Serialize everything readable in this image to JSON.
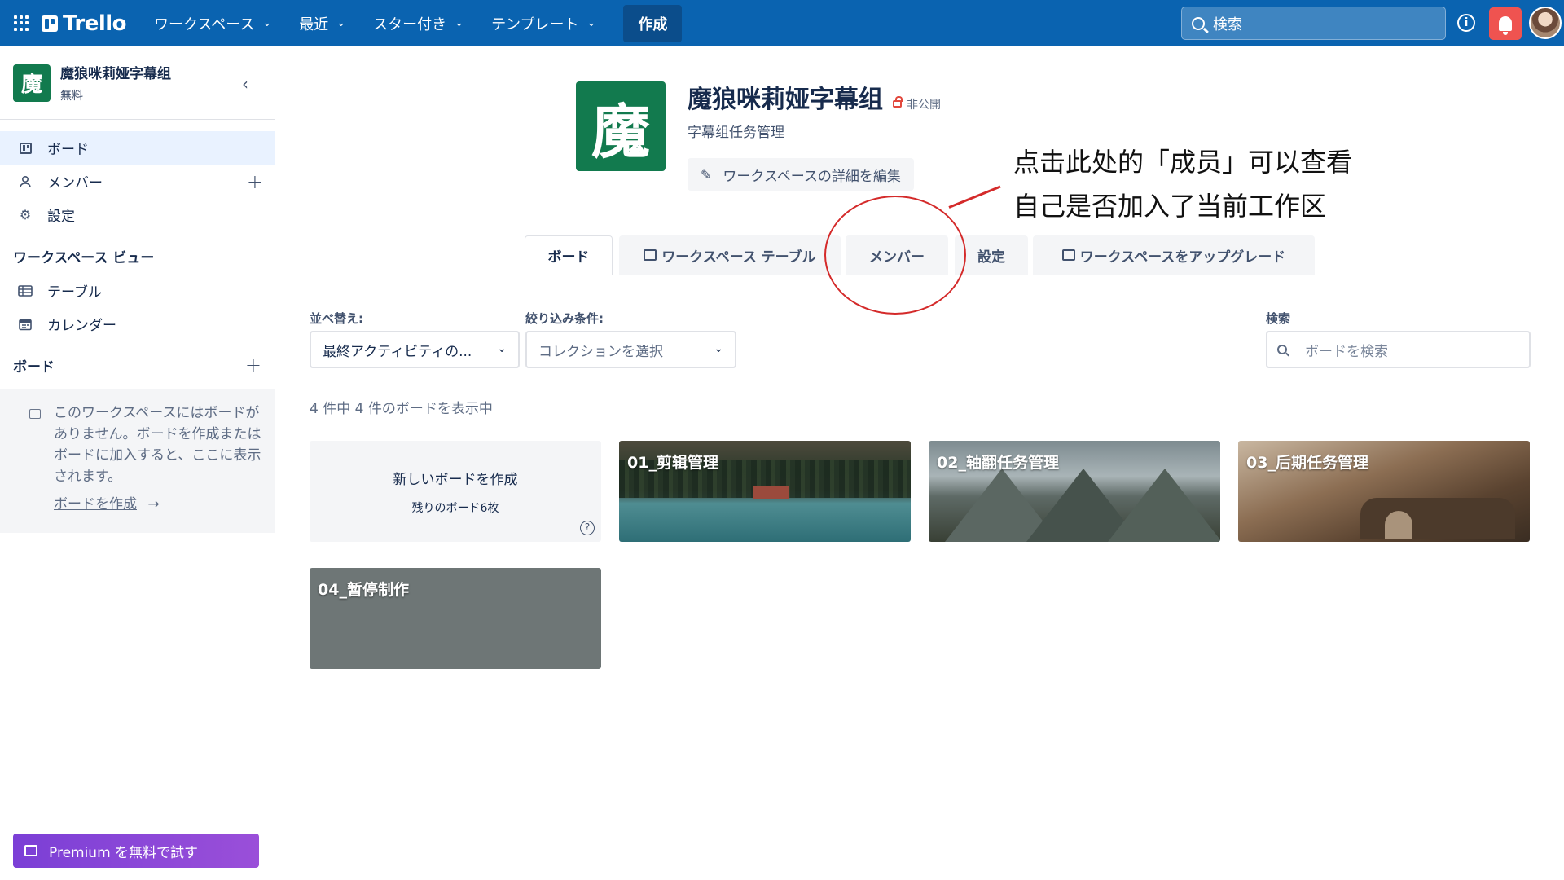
{
  "topbar": {
    "logo": "Trello",
    "nav": [
      {
        "label": "ワークスペース"
      },
      {
        "label": "最近"
      },
      {
        "label": "スター付き"
      },
      {
        "label": "テンプレート"
      }
    ],
    "create_label": "作成",
    "search_placeholder": "検索",
    "info_icon_label": "i",
    "accent": "#0a63b0",
    "notification_color": "#ef5350"
  },
  "sidebar": {
    "workspace_initial": "魔",
    "workspace_name": "魔狼咪莉娅字幕组",
    "plan": "無料",
    "collapse_icon": "‹",
    "items": [
      {
        "label": "ボード",
        "icon": "board-icon"
      },
      {
        "label": "メンバー",
        "icon": "person-icon",
        "plus": "+"
      },
      {
        "label": "設定",
        "icon": "gear-icon"
      }
    ],
    "views_heading": "ワークスペース ビュー",
    "views": [
      {
        "label": "テーブル",
        "icon": "table-icon"
      },
      {
        "label": "カレンダー",
        "icon": "calendar-icon"
      }
    ],
    "boards_heading": "ボード",
    "boards_plus": "+",
    "empty_text": "このワークスペースにはボードがありません。ボードを作成またはボードに加入すると、ここに表示されます。",
    "empty_link": "ボードを作成",
    "empty_link_arrow": "→",
    "premium_label": "Premium を無料で試す",
    "premium_color": "#8a47d8"
  },
  "workspace": {
    "logo_char": "魔",
    "title": "魔狼咪莉娅字幕组",
    "privacy": "非公開",
    "description": "字幕组任务管理",
    "edit_label": "ワークスペースの詳細を編集",
    "edit_icon": "✎",
    "logo_color": "#127a4e"
  },
  "tabs": [
    {
      "label": "ボード",
      "active": true
    },
    {
      "label": "ワークスペース テーブル",
      "icon": "premium-icon"
    },
    {
      "label": "メンバー"
    },
    {
      "label": "設定"
    },
    {
      "label": "ワークスペースをアップグレード",
      "icon": "premium-icon"
    }
  ],
  "annotation": {
    "line1": "点击此处的「成员」可以查看",
    "line2": "自己是否加入了当前工作区",
    "color": "#d42a2a"
  },
  "filters": {
    "sort_label": "並べ替え:",
    "sort_value": "最終アクティビティの...",
    "filter_label": "絞り込み条件:",
    "filter_value": "コレクションを選択",
    "search_label": "検索",
    "search_placeholder": "ボードを検索"
  },
  "count_text": "4 件中 4 件のボードを表示中",
  "new_board": {
    "title": "新しいボードを作成",
    "remaining": "残りのボード6枚",
    "help": "?"
  },
  "boards": [
    {
      "name": "01_剪辑管理"
    },
    {
      "name": "02_轴翻任务管理"
    },
    {
      "name": "03_后期任务管理"
    },
    {
      "name": "04_暂停制作",
      "color": "#6e7676"
    }
  ]
}
